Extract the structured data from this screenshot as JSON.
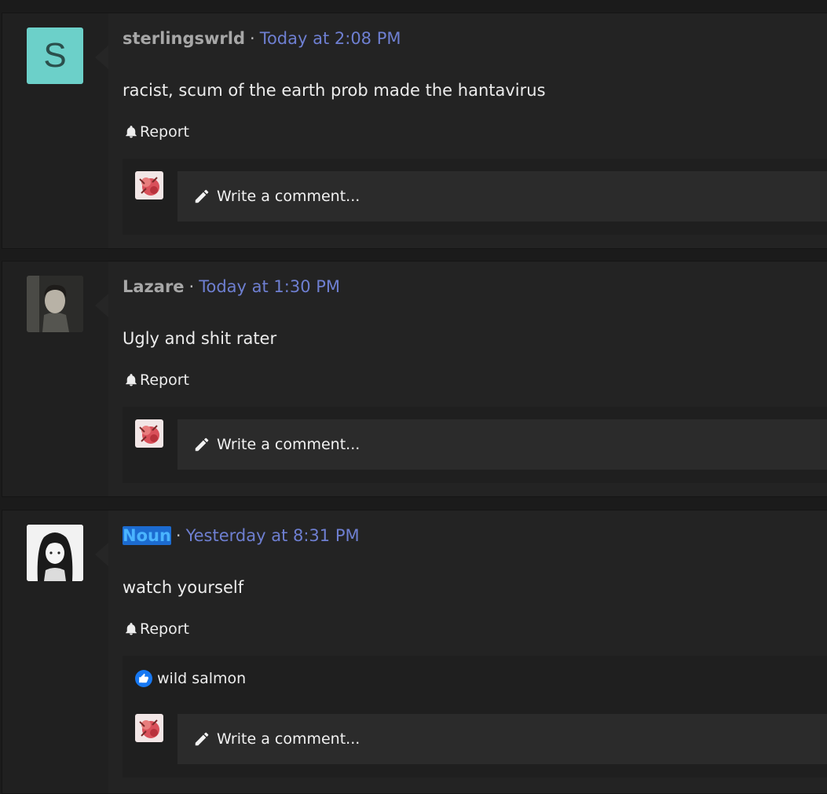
{
  "posts": [
    {
      "author": "sterlingswrld",
      "avatar_letter": "S",
      "time": "Today at 2:08 PM",
      "text": "racist, scum of the earth prob made the hantavirus",
      "report_label": "Report",
      "comment_placeholder": "Write a comment..."
    },
    {
      "author": "Lazare",
      "time": "Today at 1:30 PM",
      "text": "Ugly and shit rater",
      "report_label": "Report",
      "comment_placeholder": "Write a comment..."
    },
    {
      "author": "Noun",
      "time": "Yesterday at 8:31 PM",
      "text": "watch yourself",
      "report_label": "Report",
      "likes": "wild salmon",
      "comment_placeholder": "Write a comment..."
    }
  ],
  "separator": "·",
  "colors": {
    "accent_time": "#6e7fd1",
    "avatar_teal": "#6cd0c9",
    "like_blue": "#1778f2"
  }
}
